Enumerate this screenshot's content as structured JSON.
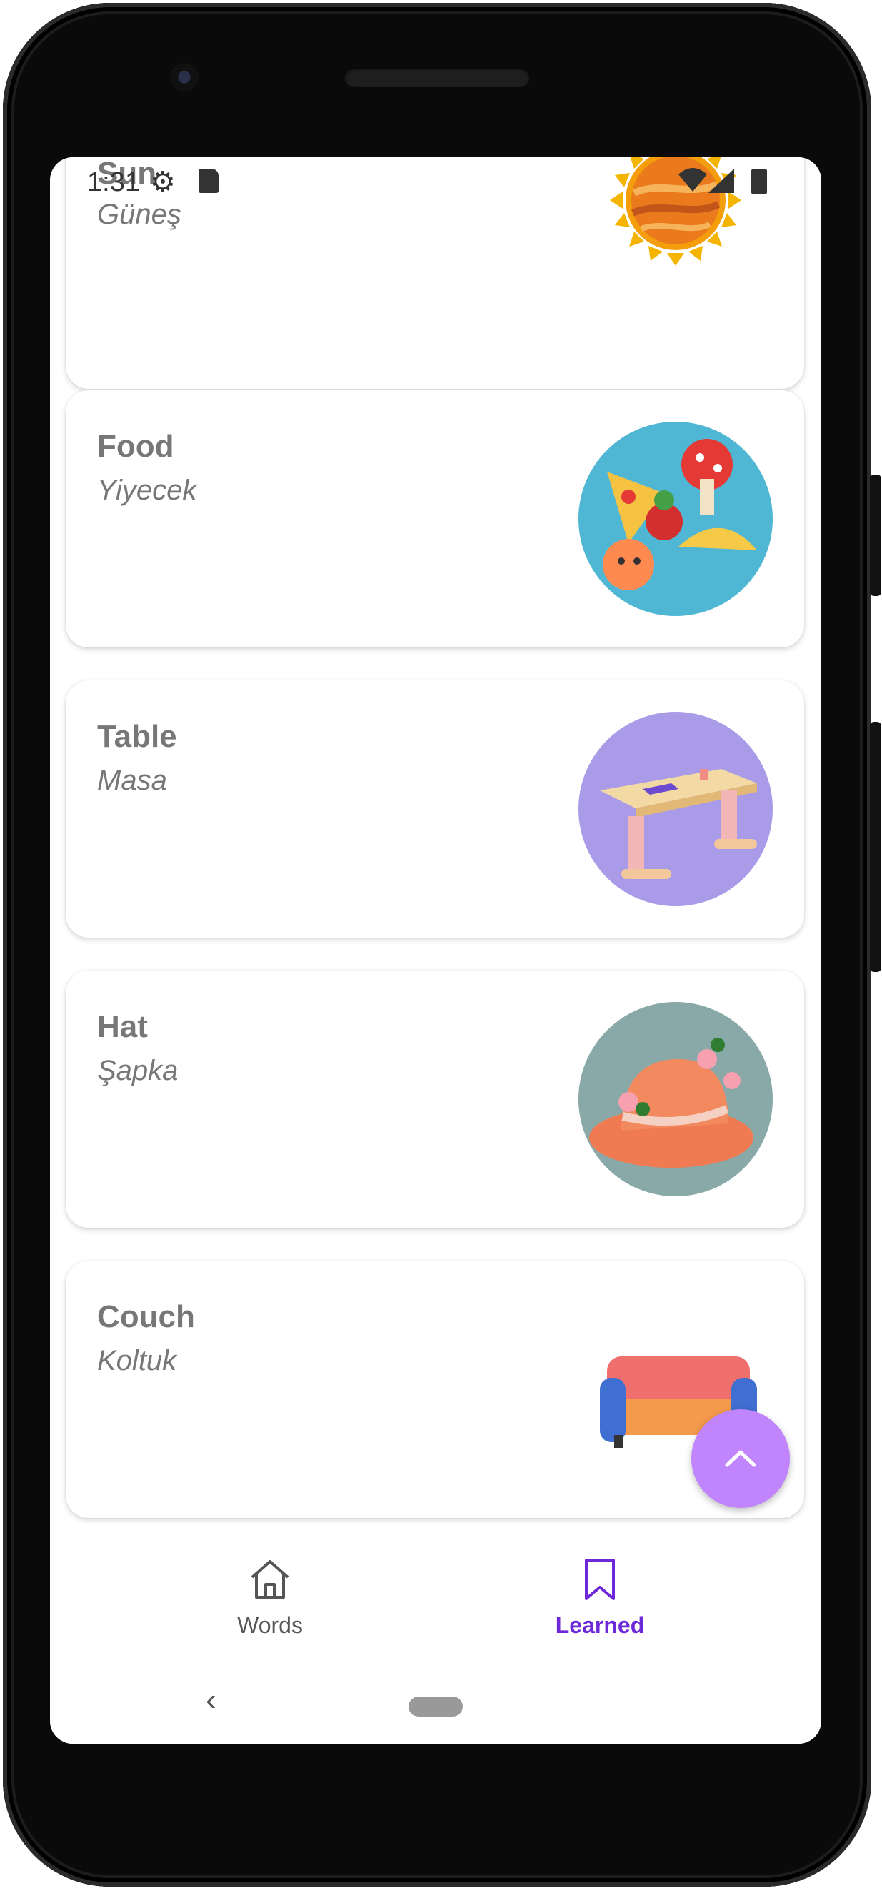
{
  "status_bar": {
    "time": "1:31",
    "icons": [
      "gear-icon",
      "sd-card-icon",
      "wifi-icon",
      "signal-icon",
      "battery-icon"
    ]
  },
  "cards": [
    {
      "word": "Sun",
      "translation": "Güneş",
      "image": "sun-image"
    },
    {
      "word": "Food",
      "translation": "Yiyecek",
      "image": "food-image"
    },
    {
      "word": "Table",
      "translation": "Masa",
      "image": "table-image"
    },
    {
      "word": "Hat",
      "translation": "Şapka",
      "image": "hat-image"
    },
    {
      "word": "Couch",
      "translation": "Koltuk",
      "image": "couch-image"
    }
  ],
  "fab": {
    "icon": "chevron-up-icon"
  },
  "bottom_nav": {
    "items": [
      {
        "label": "Words",
        "icon": "home-icon",
        "active": false
      },
      {
        "label": "Learned",
        "icon": "bookmark-icon",
        "active": true
      }
    ]
  },
  "colors": {
    "accent": "#6d28d9",
    "fab": "#c084fc",
    "text_muted": "#777777"
  }
}
